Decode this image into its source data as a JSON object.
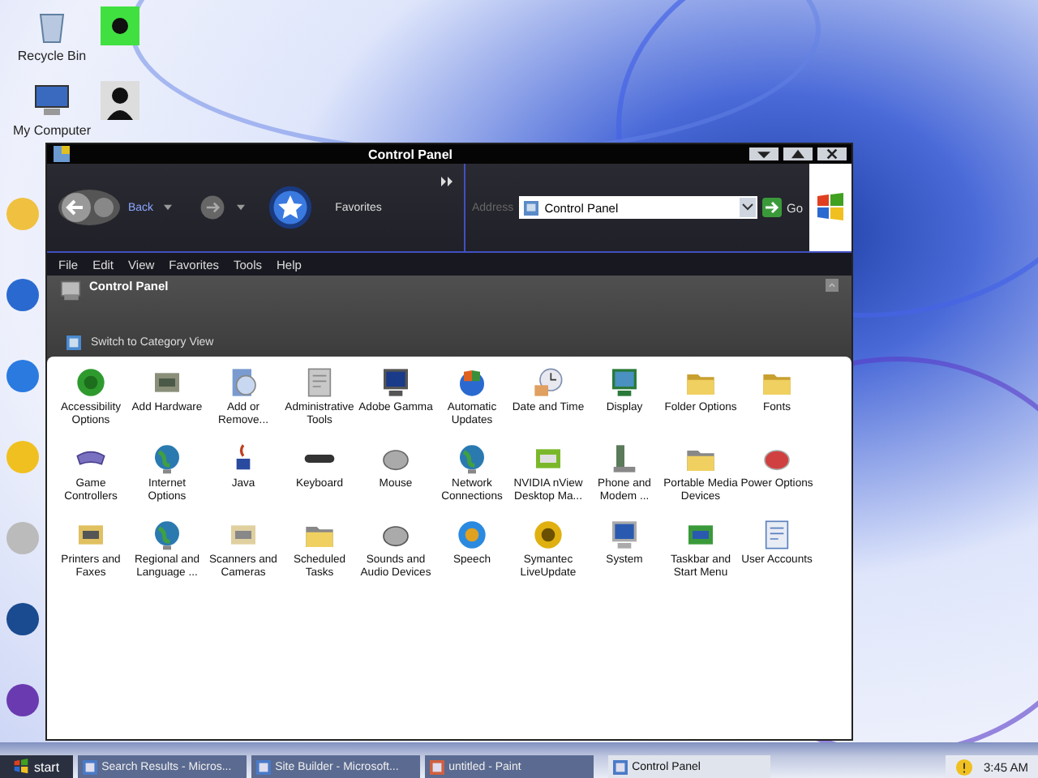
{
  "desktop_icons": [
    {
      "label": "Recycle Bin"
    },
    {
      "label": "My Computer"
    }
  ],
  "window": {
    "title": "Control Panel"
  },
  "toolbar": {
    "back": "Back",
    "favorites": "Favorites",
    "address_label": "Address",
    "address": "Control Panel",
    "go": "Go"
  },
  "menu": [
    "File",
    "Edit",
    "View",
    "Favorites",
    "Tools",
    "Help"
  ],
  "header": {
    "title": "Control Panel",
    "switch_link": "Switch to Category View"
  },
  "items": [
    {
      "label": "Accessibility Options"
    },
    {
      "label": "Add Hardware"
    },
    {
      "label": "Add or Remove..."
    },
    {
      "label": "Administrative Tools"
    },
    {
      "label": "Adobe Gamma"
    },
    {
      "label": "Automatic Updates"
    },
    {
      "label": "Date and Time"
    },
    {
      "label": "Display"
    },
    {
      "label": "Folder Options"
    },
    {
      "label": "Fonts"
    },
    {
      "label": "Game Controllers"
    },
    {
      "label": "Internet Options"
    },
    {
      "label": "Java"
    },
    {
      "label": "Keyboard"
    },
    {
      "label": "Mouse"
    },
    {
      "label": "Network Connections"
    },
    {
      "label": "NVIDIA nView Desktop Ma..."
    },
    {
      "label": "Phone and Modem ..."
    },
    {
      "label": "Portable Media Devices"
    },
    {
      "label": "Power Options"
    },
    {
      "label": "Printers and Faxes"
    },
    {
      "label": "Regional and Language ..."
    },
    {
      "label": "Scanners and Cameras"
    },
    {
      "label": "Scheduled Tasks"
    },
    {
      "label": "Sounds and Audio Devices"
    },
    {
      "label": "Speech"
    },
    {
      "label": "Symantec LiveUpdate"
    },
    {
      "label": "System"
    },
    {
      "label": "Taskbar and Start Menu"
    },
    {
      "label": "User Accounts"
    }
  ],
  "taskbar": {
    "start": "start",
    "tasks": [
      {
        "label": "Search Results - Micros...",
        "selected": false
      },
      {
        "label": "Site Builder - Microsoft...",
        "selected": false
      },
      {
        "label": "untitled - Paint",
        "selected": false
      },
      {
        "label": "Control Panel",
        "selected": true
      }
    ],
    "clock": "3:45 AM"
  }
}
